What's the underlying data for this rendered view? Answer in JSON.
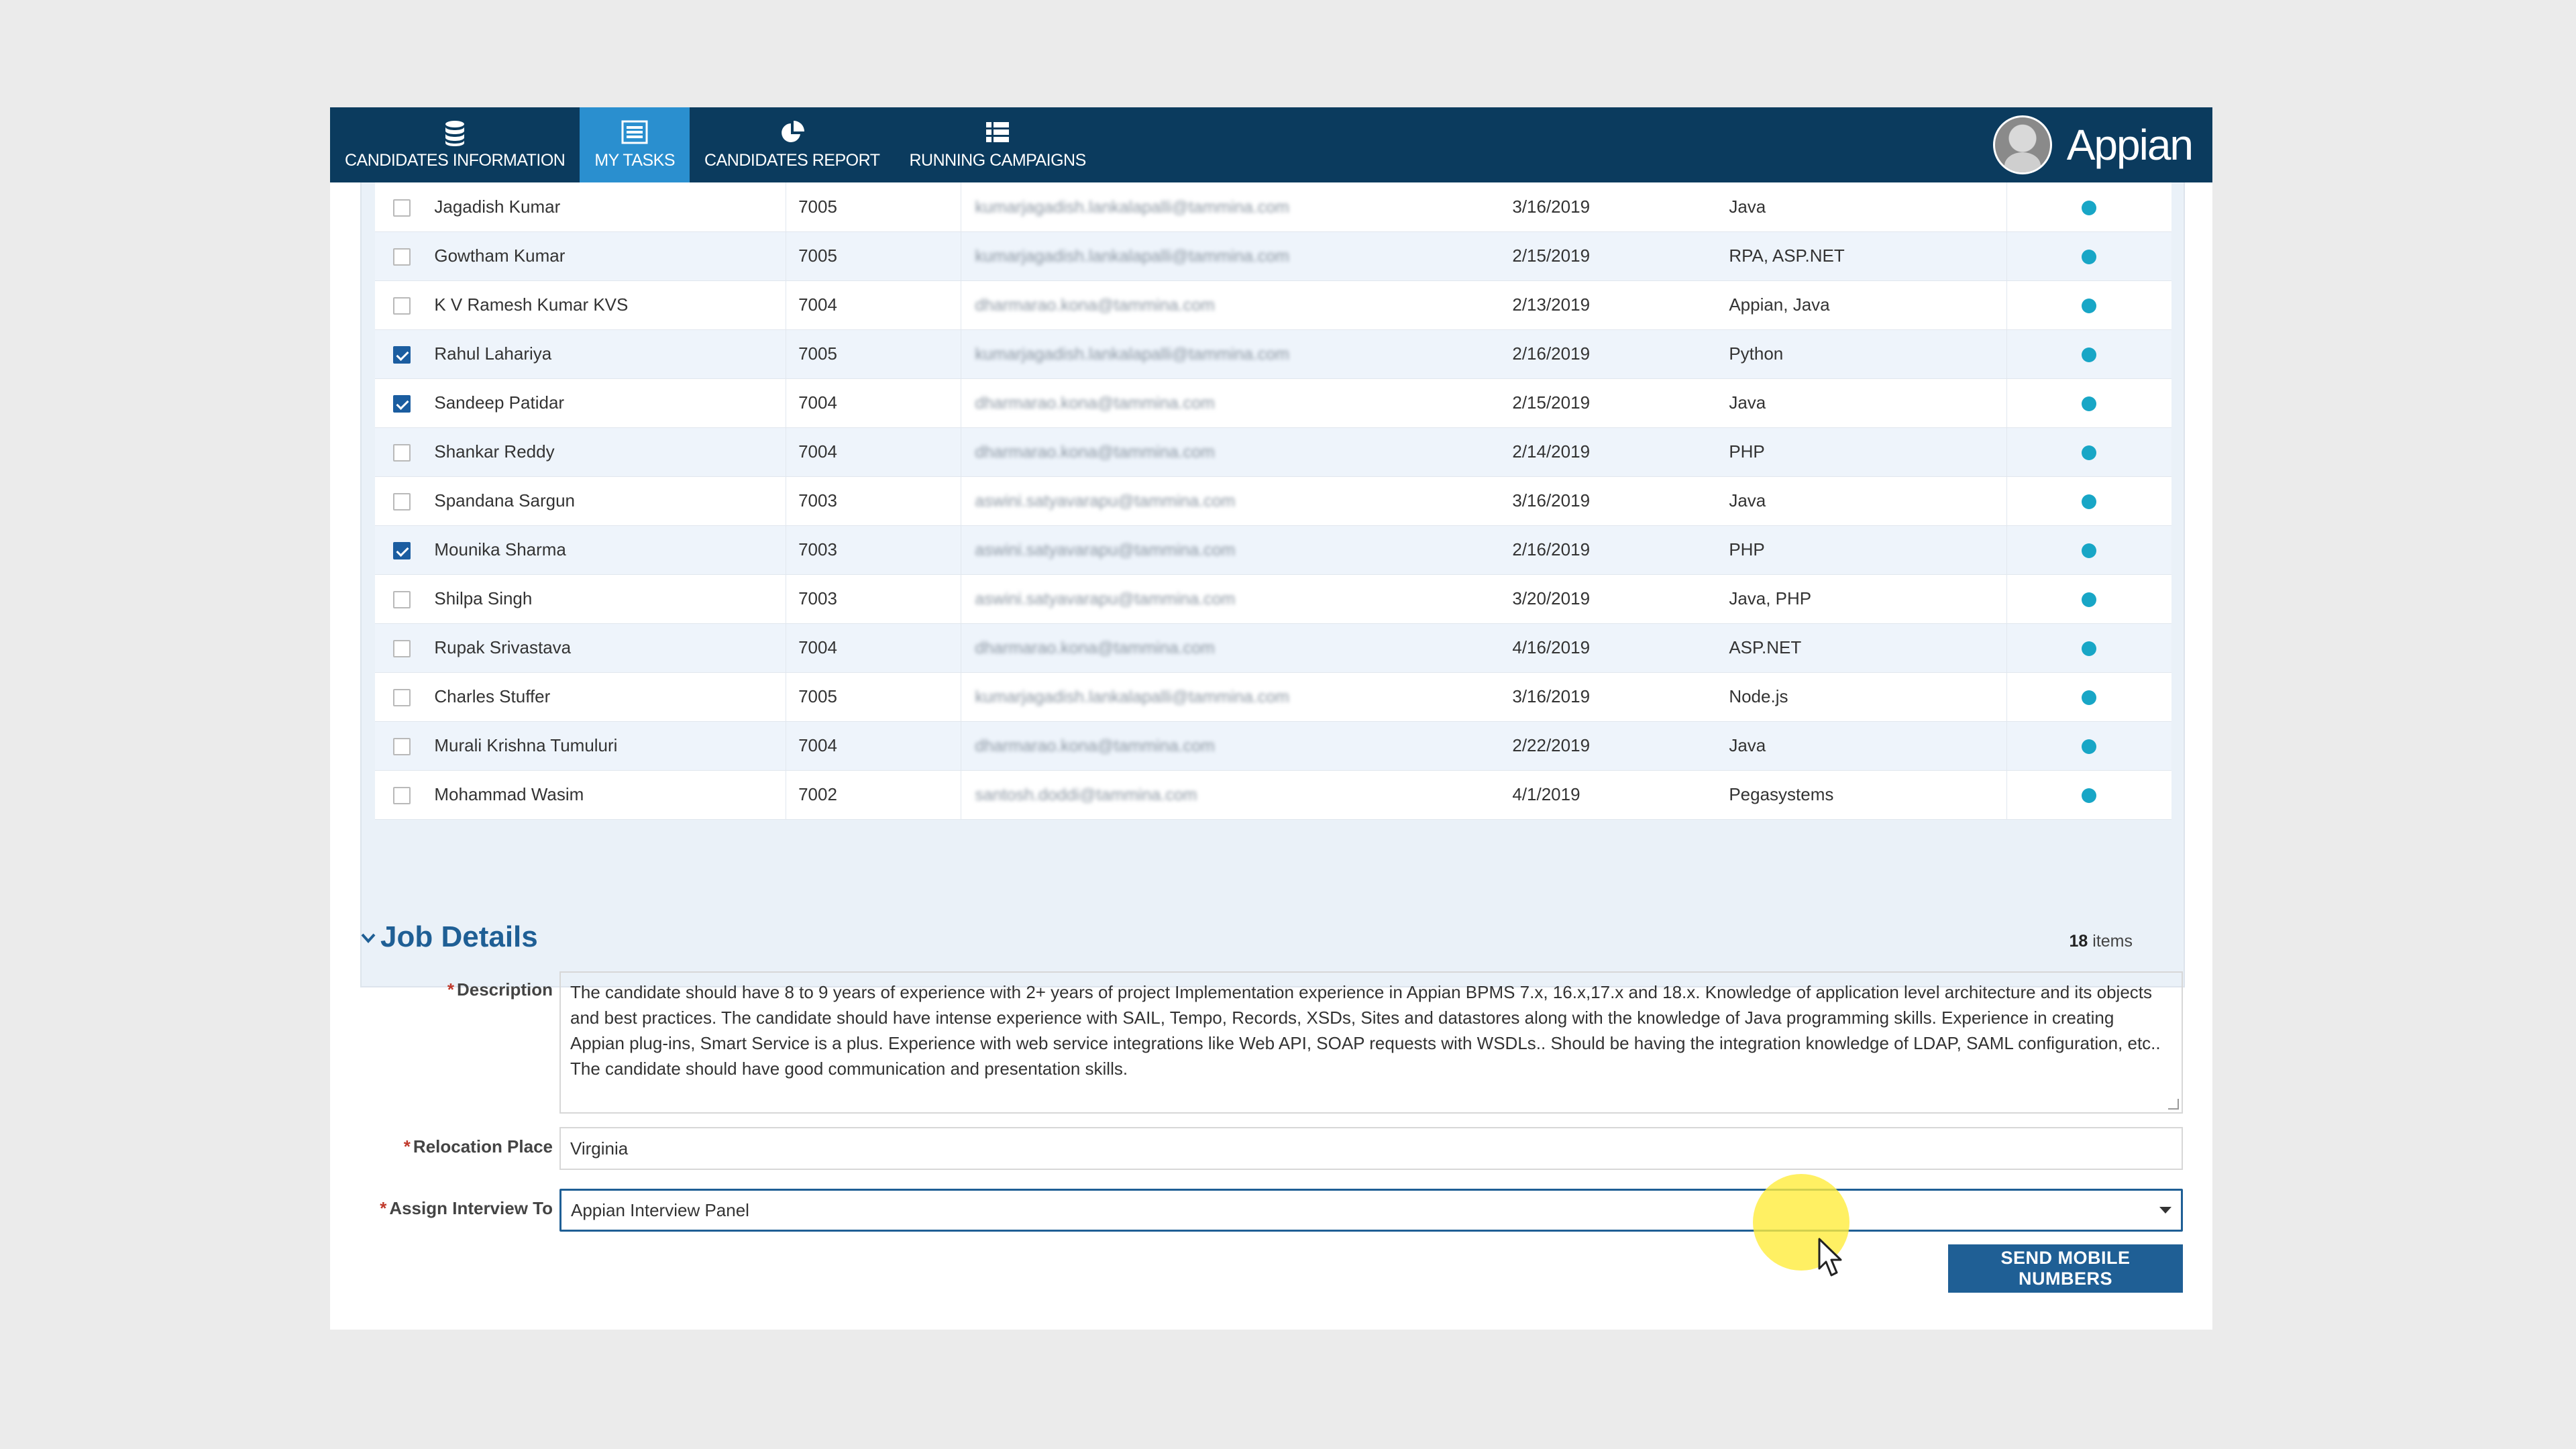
{
  "nav": {
    "tabs": [
      {
        "label": "CANDIDATES INFORMATION",
        "icon": "database-icon",
        "active": false
      },
      {
        "label": "MY TASKS",
        "icon": "tasks-icon",
        "active": true
      },
      {
        "label": "CANDIDATES REPORT",
        "icon": "pie-chart-icon",
        "active": false
      },
      {
        "label": "RUNNING CAMPAIGNS",
        "icon": "list-icon",
        "active": false
      }
    ],
    "brand": "Appian"
  },
  "grid": {
    "rows": [
      {
        "name": "Jagadish Kumar",
        "id": "7005",
        "email": "kumarjagadish.lankalapalli@tammina.com",
        "date": "3/16/2019",
        "skills": "Java",
        "checked": false
      },
      {
        "name": "Gowtham Kumar",
        "id": "7005",
        "email": "kumarjagadish.lankalapalli@tammina.com",
        "date": "2/15/2019",
        "skills": "RPA, ASP.NET",
        "checked": false
      },
      {
        "name": "K V Ramesh Kumar KVS",
        "id": "7004",
        "email": "dharmarao.kona@tammina.com",
        "date": "2/13/2019",
        "skills": "Appian, Java",
        "checked": false
      },
      {
        "name": "Rahul Lahariya",
        "id": "7005",
        "email": "kumarjagadish.lankalapalli@tammina.com",
        "date": "2/16/2019",
        "skills": "Python",
        "checked": true
      },
      {
        "name": "Sandeep Patidar",
        "id": "7004",
        "email": "dharmarao.kona@tammina.com",
        "date": "2/15/2019",
        "skills": "Java",
        "checked": true
      },
      {
        "name": "Shankar Reddy",
        "id": "7004",
        "email": "dharmarao.kona@tammina.com",
        "date": "2/14/2019",
        "skills": "PHP",
        "checked": false
      },
      {
        "name": "Spandana Sargun",
        "id": "7003",
        "email": "aswini.satyavarapu@tammina.com",
        "date": "3/16/2019",
        "skills": "Java",
        "checked": false
      },
      {
        "name": "Mounika Sharma",
        "id": "7003",
        "email": "aswini.satyavarapu@tammina.com",
        "date": "2/16/2019",
        "skills": "PHP",
        "checked": true
      },
      {
        "name": "Shilpa Singh",
        "id": "7003",
        "email": "aswini.satyavarapu@tammina.com",
        "date": "3/20/2019",
        "skills": "Java, PHP",
        "checked": false
      },
      {
        "name": "Rupak Srivastava",
        "id": "7004",
        "email": "dharmarao.kona@tammina.com",
        "date": "4/16/2019",
        "skills": "ASP.NET",
        "checked": false
      },
      {
        "name": "Charles Stuffer",
        "id": "7005",
        "email": "kumarjagadish.lankalapalli@tammina.com",
        "date": "3/16/2019",
        "skills": "Node.js",
        "checked": false
      },
      {
        "name": "Murali Krishna Tumuluri",
        "id": "7004",
        "email": "dharmarao.kona@tammina.com",
        "date": "2/22/2019",
        "skills": "Java",
        "checked": false
      },
      {
        "name": "Mohammad Wasim",
        "id": "7002",
        "email": "santosh.doddi@tammina.com",
        "date": "4/1/2019",
        "skills": "Pegasystems",
        "checked": false
      }
    ],
    "count": "18",
    "count_suffix": "items",
    "status_color": "#18a6c6"
  },
  "job": {
    "title": "Job Details",
    "required_mark": "*",
    "description_label": "Description",
    "description": "The candidate should have 8 to 9 years of experience with 2+ years of project Implementation experience in Appian BPMS 7.x, 16.x,17.x and 18.x. Knowledge of application level architecture and its objects and best practices. The candidate should have intense experience with SAIL, Tempo, Records, XSDs, Sites and datastores along with the knowledge of Java programming skills. Experience in creating Appian plug-ins, Smart Service is a plus. Experience with web service integrations like Web API, SOAP requests with WSDLs.. Should be having the integration knowledge of LDAP, SAML configuration, etc.. The candidate should have good communication and presentation skills.",
    "relocation_label": "Relocation Place",
    "relocation_value": "Virginia",
    "assign_label": "Assign Interview To",
    "assign_value": "Appian Interview Panel",
    "send_button": "SEND MOBILE NUMBERS"
  },
  "colors": {
    "nav_bg": "#0b3b5e",
    "nav_active": "#2a8fcf",
    "accent": "#1f5f95",
    "link": "#1f6fa8"
  }
}
